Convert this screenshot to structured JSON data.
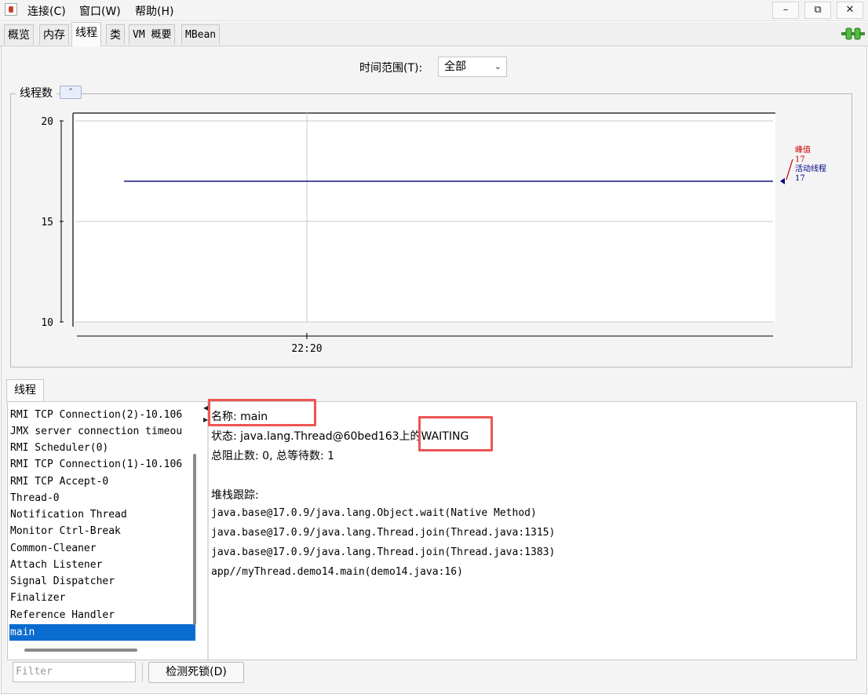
{
  "menubar": {
    "items": [
      "连接(C)",
      "窗口(W)",
      "帮助(H)"
    ],
    "window_controls": [
      "minimize-icon",
      "restore-icon",
      "close-icon"
    ]
  },
  "tabs": [
    "概览",
    "内存",
    "线程",
    "类",
    "VM 概要",
    "MBean"
  ],
  "active_tab": "线程",
  "time_range": {
    "label": "时间范围(T):",
    "value": "全部"
  },
  "chart_section": {
    "title": "线程数"
  },
  "chart_data": {
    "type": "line",
    "title": "线程数",
    "x": [
      "22:20"
    ],
    "y_ticks": [
      10,
      15,
      20
    ],
    "ylim": [
      10,
      20
    ],
    "grid": true,
    "series": [
      {
        "name": "峰值",
        "value": 17,
        "color": "#cc0000"
      },
      {
        "name": "活动线程",
        "value": 17,
        "color": "#000080"
      }
    ],
    "legend_position": "right"
  },
  "legend": {
    "peak_label": "峰值",
    "peak_value": "17",
    "active_label": "活动线程",
    "active_value": "17"
  },
  "threads_panel": {
    "tab_label": "线程",
    "threads": [
      "RMI TCP Connection(2)-10.106",
      "JMX server connection timeou",
      "RMI Scheduler(0)",
      "RMI TCP Connection(1)-10.106",
      "RMI TCP Accept-0",
      "Thread-0",
      "Notification Thread",
      "Monitor Ctrl-Break",
      "Common-Cleaner",
      "Attach Listener",
      "Signal Dispatcher",
      "Finalizer",
      "Reference Handler",
      "main"
    ],
    "selected": "main"
  },
  "details": {
    "name_line": "名称: main",
    "state_line": "状态: java.lang.Thread@60bed163上的WAITING",
    "block_line": "总阻止数: 0, 总等待数: 1",
    "stack_title": "堆栈跟踪:",
    "stack": [
      "java.base@17.0.9/java.lang.Object.wait(Native Method)",
      "java.base@17.0.9/java.lang.Thread.join(Thread.java:1315)",
      "java.base@17.0.9/java.lang.Thread.join(Thread.java:1383)",
      "app//myThread.demo14.main(demo14.java:16)"
    ]
  },
  "filter": {
    "placeholder": "Filter"
  },
  "deadlock_button": "检测死锁(D)"
}
